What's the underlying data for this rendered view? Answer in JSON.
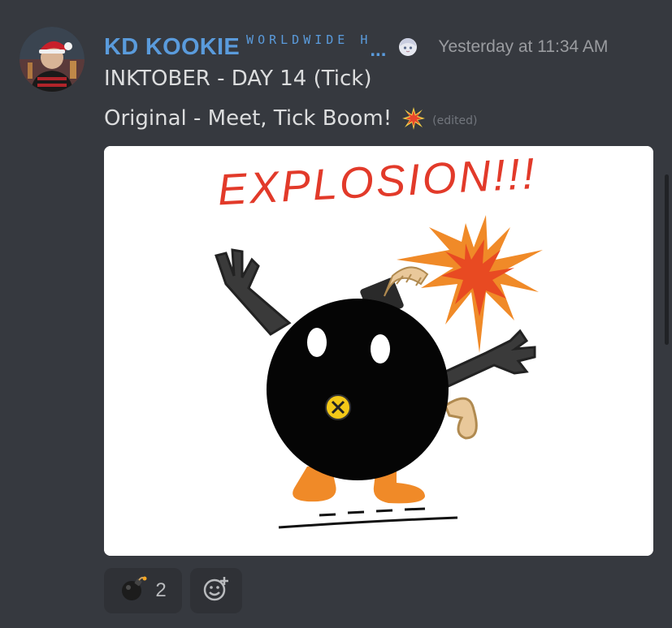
{
  "message": {
    "author": {
      "name": "KD KOOKIE",
      "tag": "WORLDWIDE H",
      "tag_ellipsis": "..."
    },
    "timestamp": "Yesterday at 11:34 AM",
    "line1": "INKTOBER - DAY 14 (Tick)",
    "line2": "Original - Meet, Tick Boom!",
    "edited": "(edited)",
    "attachment": {
      "drawing_text": "EXPLOSION!!!"
    }
  },
  "reactions": [
    {
      "emoji": "bomb-icon",
      "count": "2"
    }
  ],
  "icons": {
    "role": "anime-girl-icon",
    "burst": "collision-icon",
    "add_reaction": "add-reaction-icon"
  },
  "colors": {
    "background": "#36393f",
    "username": "#5a9bdc",
    "timestamp": "#9a9ca0",
    "text": "#dcddde",
    "reaction_bg": "#2f3136",
    "drawing_red": "#e23a2a",
    "drawing_orange": "#f08a28"
  }
}
